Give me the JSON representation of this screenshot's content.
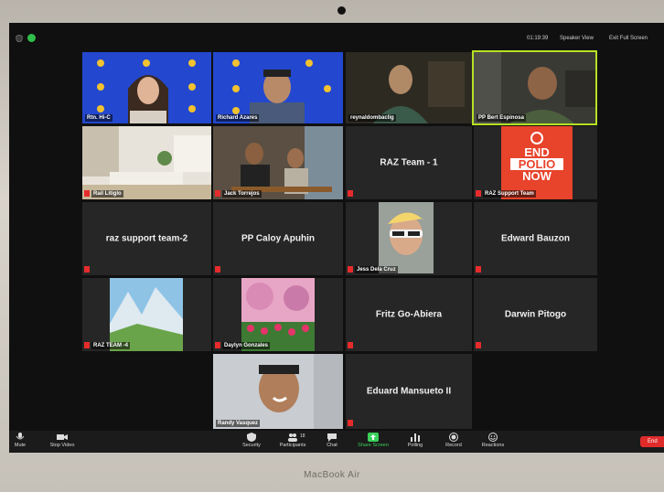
{
  "topbar": {
    "time": "01:19:39",
    "view_label": "Speaker View",
    "fullscreen_label": "Exit Full Screen"
  },
  "tiles": {
    "t1": {
      "name": "Rtn. Hi-C",
      "bg": "Rotary"
    },
    "t2": {
      "name": "Richard Azares",
      "bg": "Rotary"
    },
    "t3": {
      "name": "reynaldombaclig"
    },
    "t4": {
      "name": "PP Bert Espinosa"
    },
    "t5": {
      "name": "Rail Litiglo"
    },
    "t6": {
      "name": "Jack Torrejos"
    },
    "t7": {
      "big": "RAZ Team - 1"
    },
    "t8": {
      "name": "RAZ Support Team",
      "poster_line1": "END",
      "poster_line2": "POLIO",
      "poster_line3": "NOW"
    },
    "t9": {
      "big": "raz support team-2"
    },
    "t10": {
      "big": "PP Caloy Apuhin"
    },
    "t11": {
      "name": "Jess Dela Cruz"
    },
    "t12": {
      "big": "Edward Bauzon"
    },
    "t13": {
      "name": "RAZ TEAM -4"
    },
    "t14": {
      "name": "Daylyn Gonzales"
    },
    "t15": {
      "big": "Fritz Go-Abiera"
    },
    "t16": {
      "big": "Darwin Pitogo"
    },
    "t17": {
      "name": "Randy Vasquez"
    },
    "t18": {
      "big": "Eduard Mansueto II"
    }
  },
  "toolbar": {
    "mute": "Mute",
    "stop_video": "Stop Video",
    "security": "Security",
    "participants": "Participants",
    "participants_count": "18",
    "chat": "Chat",
    "share_screen": "Share Screen",
    "polling": "Polling",
    "record": "Record",
    "reactions": "Reactions",
    "end": "End"
  },
  "laptop": {
    "brand": "MacBook Air"
  },
  "colors": {
    "active_speaker": "#b6e024",
    "share_green": "#3ad15a",
    "end_red": "#e02b2b"
  }
}
